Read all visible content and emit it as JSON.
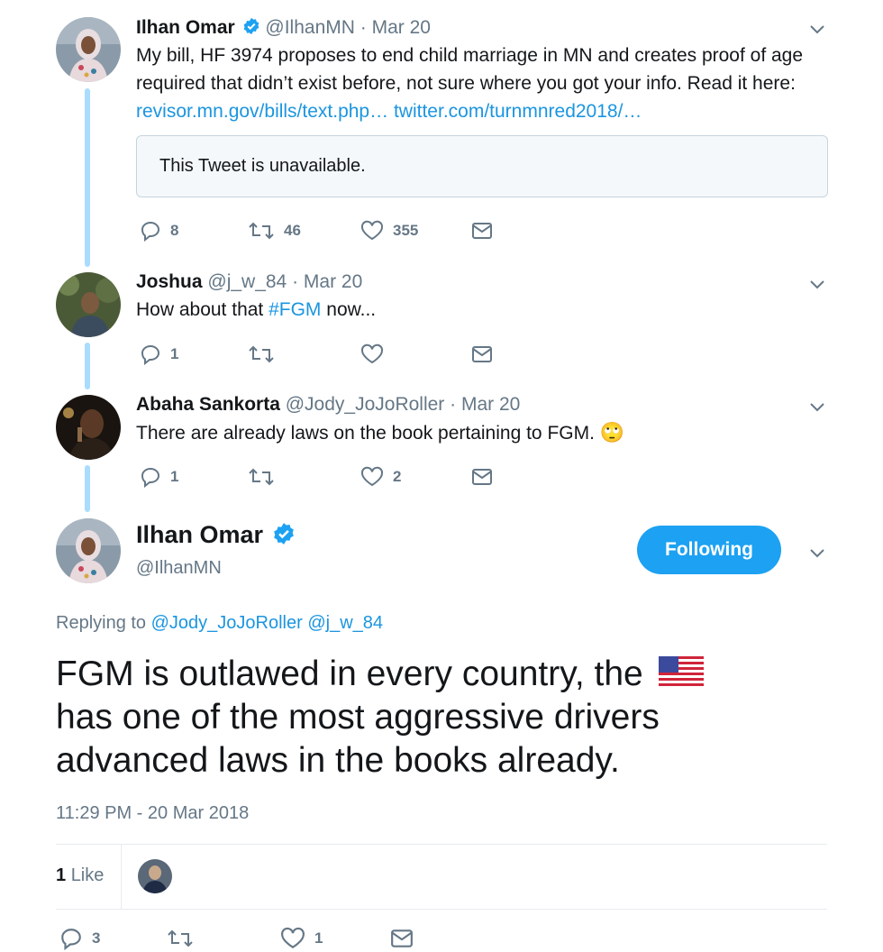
{
  "tweet1": {
    "name": "Ilhan Omar",
    "handle": "@IlhanMN",
    "date": "· Mar 20",
    "text_line1": "My bill, HF 3974 proposes to end child marriage in MN and creates proof of age",
    "text_line2": "required that didn’t exist before, not sure where you got your info. Read it here:",
    "link1": "revisor.mn.gov/bills/text.php…",
    "link2": "twitter.com/turnmnred2018/…",
    "quote_unavailable": "This Tweet is unavailable.",
    "replies": "8",
    "retweets": "46",
    "likes": "355"
  },
  "tweet2": {
    "name": "Joshua",
    "handle": "@j_w_84",
    "date": "· Mar 20",
    "text_before": "How about that ",
    "hashtag": "#FGM",
    "text_after": " now...",
    "replies": "1",
    "retweets": "",
    "likes": ""
  },
  "tweet3": {
    "name": "Abaha Sankorta",
    "handle": "@Jody_JoJoRoller",
    "date": "· Mar 20",
    "text": "There are already laws on the book pertaining to FGM.",
    "emoji": "🙄",
    "replies": "1",
    "retweets": "",
    "likes": "2"
  },
  "main": {
    "name": "Ilhan Omar",
    "handle": "@IlhanMN",
    "follow_label": "Following",
    "replying_prefix": "Replying to",
    "reply_mention1": "@Jody_JoJoRoller",
    "reply_mention2": "@j_w_84",
    "text_line1": "FGM is outlawed in every country, the",
    "text_line2": "has one of the most aggressive drivers",
    "text_line3": "advanced laws in the books already.",
    "timestamp": "11:29 PM - 20 Mar 2018",
    "likes_count": "1",
    "likes_label": "Like",
    "replies": "3",
    "likes": "1"
  },
  "colors": {
    "accent": "#1da1f2",
    "link": "#1b95e0",
    "thread_line": "#aadcff",
    "muted": "#657786"
  },
  "icons": [
    "verified-badge-icon",
    "chevron-down-icon",
    "reply-icon",
    "retweet-icon",
    "like-icon",
    "message-icon",
    "us-flag-icon",
    "eye-roll-emoji-icon"
  ]
}
